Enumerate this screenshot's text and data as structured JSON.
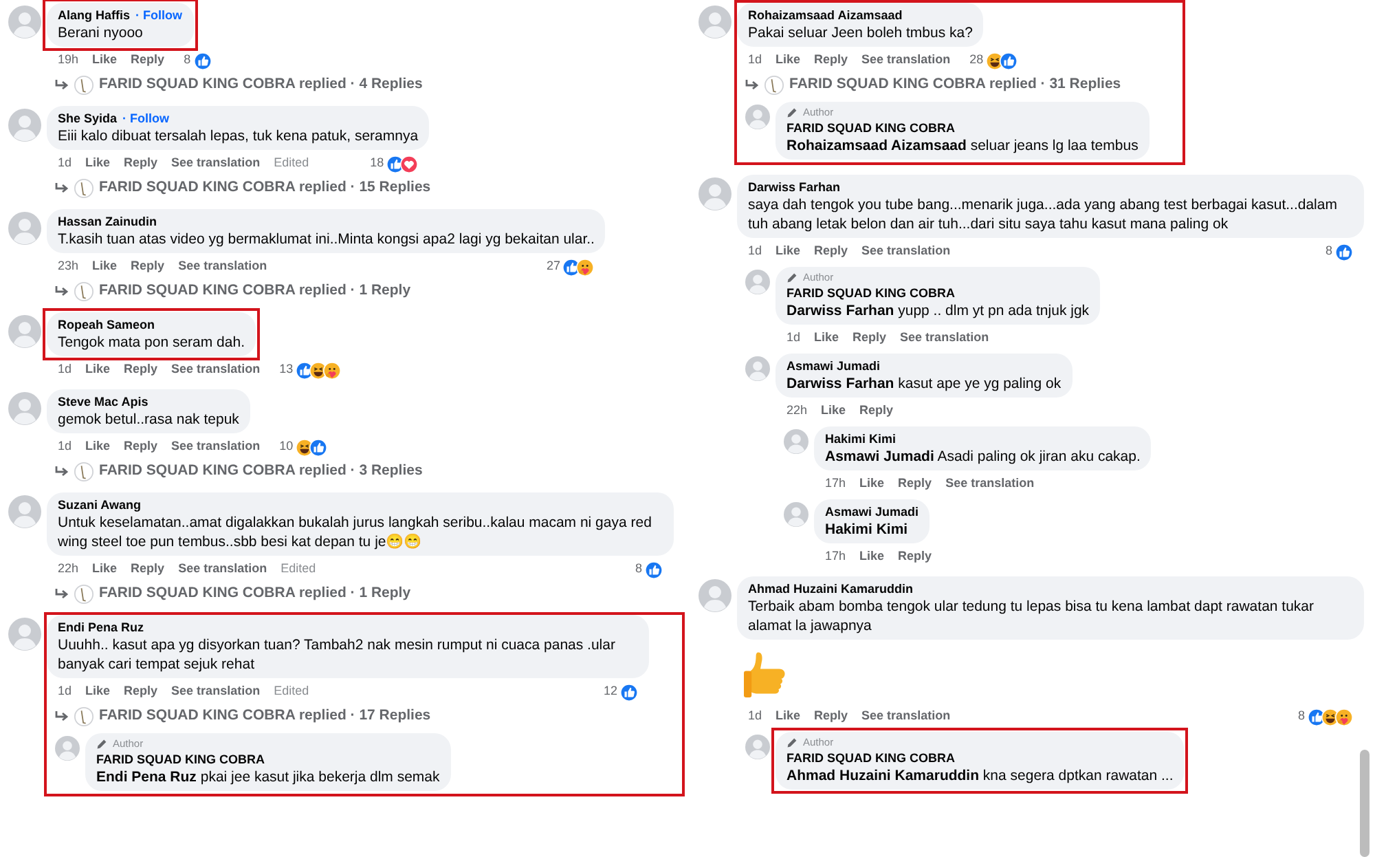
{
  "columns": [
    {
      "comments": [
        {
          "name": "Alang Haffis",
          "follow": "· Follow",
          "text": "Berani nyooo",
          "highlighted": true,
          "time": "19h",
          "actions": [
            "Like",
            "Reply"
          ],
          "count": "8",
          "reactions": [
            {
              "kind": "like"
            }
          ],
          "replies_link": "FARID SQUAD KING COBRA replied · 4 Replies"
        },
        {
          "name": "She Syida",
          "follow": "· Follow",
          "text": "Eiii kalo dibuat tersalah lepas, tuk kena patuk, seramnya",
          "time": "1d",
          "actions": [
            "Like",
            "Reply",
            "See translation"
          ],
          "edited": "Edited",
          "count": "18",
          "reactions": [
            {
              "kind": "like"
            },
            {
              "kind": "love"
            }
          ],
          "replies_link": "FARID SQUAD KING COBRA replied · 15 Replies"
        },
        {
          "name": "Hassan Zainudin",
          "text": "T.kasih tuan atas video yg bermaklumat ini..Minta kongsi apa2 lagi yg bekaitan ular..",
          "time": "23h",
          "actions": [
            "Like",
            "Reply",
            "See translation"
          ],
          "count": "27",
          "reactions": [
            {
              "kind": "like"
            },
            {
              "kind": "care"
            }
          ],
          "replies_link": "FARID SQUAD KING COBRA replied · 1 Reply"
        },
        {
          "name": "Ropeah Sameon",
          "text": "Tengok mata pon seram dah.",
          "highlighted": true,
          "time": "1d",
          "actions": [
            "Like",
            "Reply",
            "See translation"
          ],
          "count": "13",
          "reactions": [
            {
              "kind": "like"
            },
            {
              "kind": "haha"
            },
            {
              "kind": "care"
            }
          ]
        },
        {
          "name": "Steve Mac Apis",
          "text": "gemok betul..rasa nak tepuk",
          "time": "1d",
          "actions": [
            "Like",
            "Reply",
            "See translation"
          ],
          "count": "10",
          "reactions": [
            {
              "kind": "haha"
            },
            {
              "kind": "like"
            }
          ],
          "replies_link": "FARID SQUAD KING COBRA replied · 3 Replies"
        },
        {
          "name": "Suzani Awang",
          "text": "Untuk keselamatan..amat digalakkan bukalah jurus langkah seribu..kalau macam ni gaya red wing steel toe pun tembus..sbb besi kat depan tu je😁😁",
          "time": "22h",
          "actions": [
            "Like",
            "Reply",
            "See translation"
          ],
          "edited": "Edited",
          "count": "8",
          "reactions": [
            {
              "kind": "like"
            }
          ],
          "replies_link": "FARID SQUAD KING COBRA replied · 1 Reply"
        },
        {
          "name": "Endi Pena Ruz",
          "text": "Uuuhh.. kasut apa yg disyorkan tuan? Tambah2 nak mesin rumput ni cuaca panas .ular banyak cari tempat sejuk rehat",
          "thread_highlighted": true,
          "time": "1d",
          "actions": [
            "Like",
            "Reply",
            "See translation"
          ],
          "edited": "Edited",
          "count": "12",
          "reactions": [
            {
              "kind": "like"
            }
          ],
          "replies_link": "FARID SQUAD KING COBRA replied · 17 Replies",
          "replies": [
            {
              "badge": "Author",
              "name": "FARID SQUAD KING COBRA",
              "text": "**Endi Pena Ruz** pkai jee kasut jika bekerja dlm semak"
            }
          ]
        }
      ]
    },
    {
      "comments": [
        {
          "name": "Rohaizamsaad Aizamsaad",
          "text": "Pakai seluar Jeen boleh tmbus ka?",
          "thread_highlighted": true,
          "time": "1d",
          "actions": [
            "Like",
            "Reply",
            "See translation"
          ],
          "count": "28",
          "reactions": [
            {
              "kind": "haha"
            },
            {
              "kind": "like"
            }
          ],
          "replies_link": "FARID SQUAD KING COBRA replied · 31 Replies",
          "replies": [
            {
              "badge": "Author",
              "name": "FARID SQUAD KING COBRA",
              "text": "**Rohaizamsaad Aizamsaad** seluar jeans lg laa tembus"
            }
          ]
        },
        {
          "name": "Darwiss Farhan",
          "text": "saya dah tengok you tube bang...menarik juga...ada yang abang test berbagai kasut...dalam tuh abang letak belon dan air tuh...dari situ saya tahu kasut mana paling ok",
          "time": "1d",
          "actions": [
            "Like",
            "Reply",
            "See translation"
          ],
          "count": "8",
          "reactions": [
            {
              "kind": "like"
            }
          ],
          "replies": [
            {
              "badge": "Author",
              "name": "FARID SQUAD KING COBRA",
              "text": "**Darwiss Farhan** yupp .. dlm yt pn ada tnjuk jgk",
              "time": "1d",
              "actions": [
                "Like",
                "Reply",
                "See translation"
              ]
            },
            {
              "name": "Asmawi Jumadi",
              "text": "**Darwiss Farhan** kasut ape ye yg paling ok",
              "time": "22h",
              "actions": [
                "Like",
                "Reply"
              ],
              "replies": [
                {
                  "name": "Hakimi Kimi",
                  "text": "**Asmawi Jumadi** Asadi paling ok jiran aku cakap.",
                  "time": "17h",
                  "actions": [
                    "Like",
                    "Reply",
                    "See translation"
                  ]
                },
                {
                  "name": "Asmawi Jumadi",
                  "text": "**Hakimi Kimi**",
                  "time": "17h",
                  "actions": [
                    "Like",
                    "Reply"
                  ]
                }
              ]
            }
          ]
        },
        {
          "name": "Ahmad Huzaini Kamaruddin",
          "text": "Terbaik abam bomba tengok ular tedung tu lepas bisa tu kena lambat dapt rawatan tukar alamat la jawapnya",
          "attachment": {
            "kind": "thumbs_up"
          },
          "time": "1d",
          "actions": [
            "Like",
            "Reply",
            "See translation"
          ],
          "count": "8",
          "reactions": [
            {
              "kind": "like"
            },
            {
              "kind": "haha"
            },
            {
              "kind": "care"
            }
          ],
          "replies": [
            {
              "badge": "Author",
              "name": "FARID SQUAD KING COBRA",
              "text": "**Ahmad Huzaini Kamaruddin** kna segera dptkan rawatan ...",
              "highlighted": true
            }
          ]
        }
      ]
    }
  ]
}
